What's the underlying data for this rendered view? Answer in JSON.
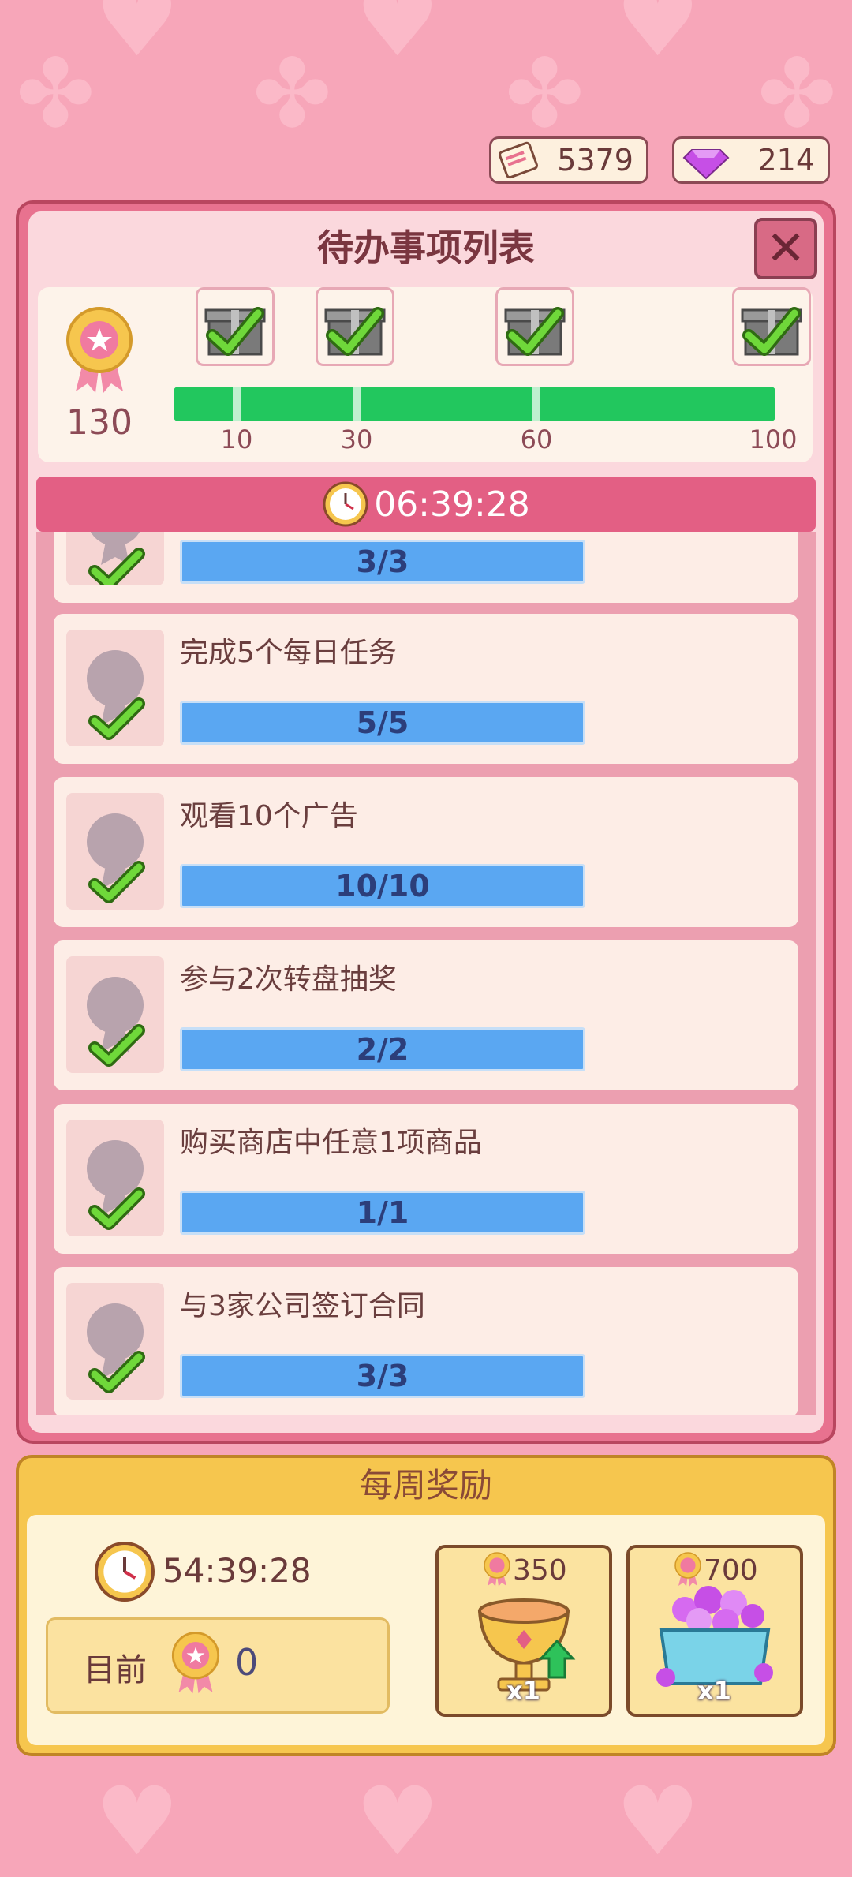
{
  "currencies": {
    "tickets": {
      "value": "5379",
      "icon": "ticket-icon"
    },
    "gems": {
      "value": "214",
      "icon": "gem-icon"
    }
  },
  "panel": {
    "title": "待办事项列表",
    "close_icon": "close-icon"
  },
  "progress": {
    "points": "130",
    "fill_fraction": 1.0,
    "milestones": [
      "10",
      "30",
      "60",
      "100"
    ]
  },
  "timer": "06:39:28",
  "tasks": [
    {
      "name": "",
      "progress": "3/3",
      "completed": true
    },
    {
      "name": "完成5个每日任务",
      "progress": "5/5",
      "completed": true
    },
    {
      "name": "观看10个广告",
      "progress": "10/10",
      "completed": true
    },
    {
      "name": "参与2次转盘抽奖",
      "progress": "2/2",
      "completed": true
    },
    {
      "name": "购买商店中任意1项商品",
      "progress": "1/1",
      "completed": true
    },
    {
      "name": "与3家公司签订合同",
      "progress": "3/3",
      "completed": true
    }
  ],
  "weekly": {
    "title": "每周奖励",
    "timer": "54:39:28",
    "current_label": "目前",
    "current_value": "0",
    "rewards": [
      {
        "cost": "350",
        "qty": "x1",
        "icon": "trophy-cup-icon"
      },
      {
        "cost": "700",
        "qty": "x1",
        "icon": "gem-chest-icon"
      }
    ]
  },
  "colors": {
    "background": "#f7a6b9",
    "progress_green": "#22c75e",
    "task_bar_blue": "#5aa7f2",
    "timer_bar": "#e35f84",
    "weekly_gold": "#f6c64e"
  }
}
